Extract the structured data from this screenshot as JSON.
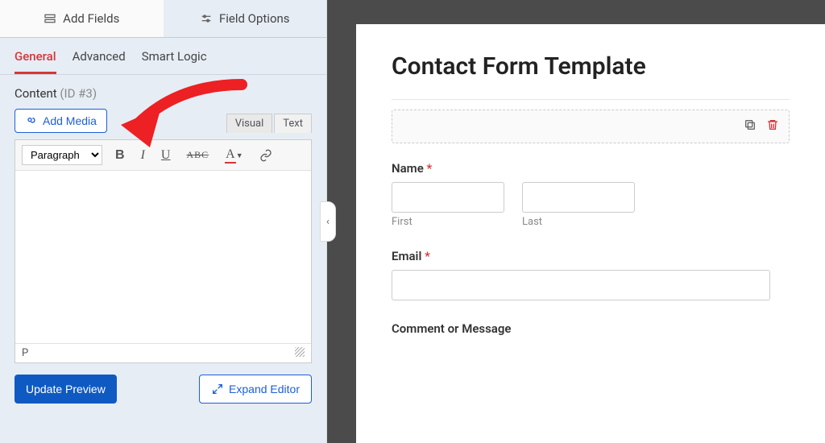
{
  "builder": {
    "tabs": {
      "add_fields": "Add Fields",
      "field_options": "Field Options"
    }
  },
  "subtabs": {
    "general": "General",
    "advanced": "Advanced",
    "smart_logic": "Smart Logic"
  },
  "content": {
    "label": "Content",
    "id": "(ID #3)"
  },
  "media": {
    "add_media": "Add Media"
  },
  "editor": {
    "tabs": {
      "visual": "Visual",
      "text": "Text"
    },
    "format": "Paragraph",
    "status_letter": "P"
  },
  "actions": {
    "update_preview": "Update Preview",
    "expand_editor": "Expand Editor"
  },
  "form": {
    "title": "Contact Form Template",
    "name": {
      "label": "Name",
      "first": "First",
      "last": "Last"
    },
    "email": {
      "label": "Email"
    },
    "comment": {
      "label": "Comment or Message"
    }
  }
}
